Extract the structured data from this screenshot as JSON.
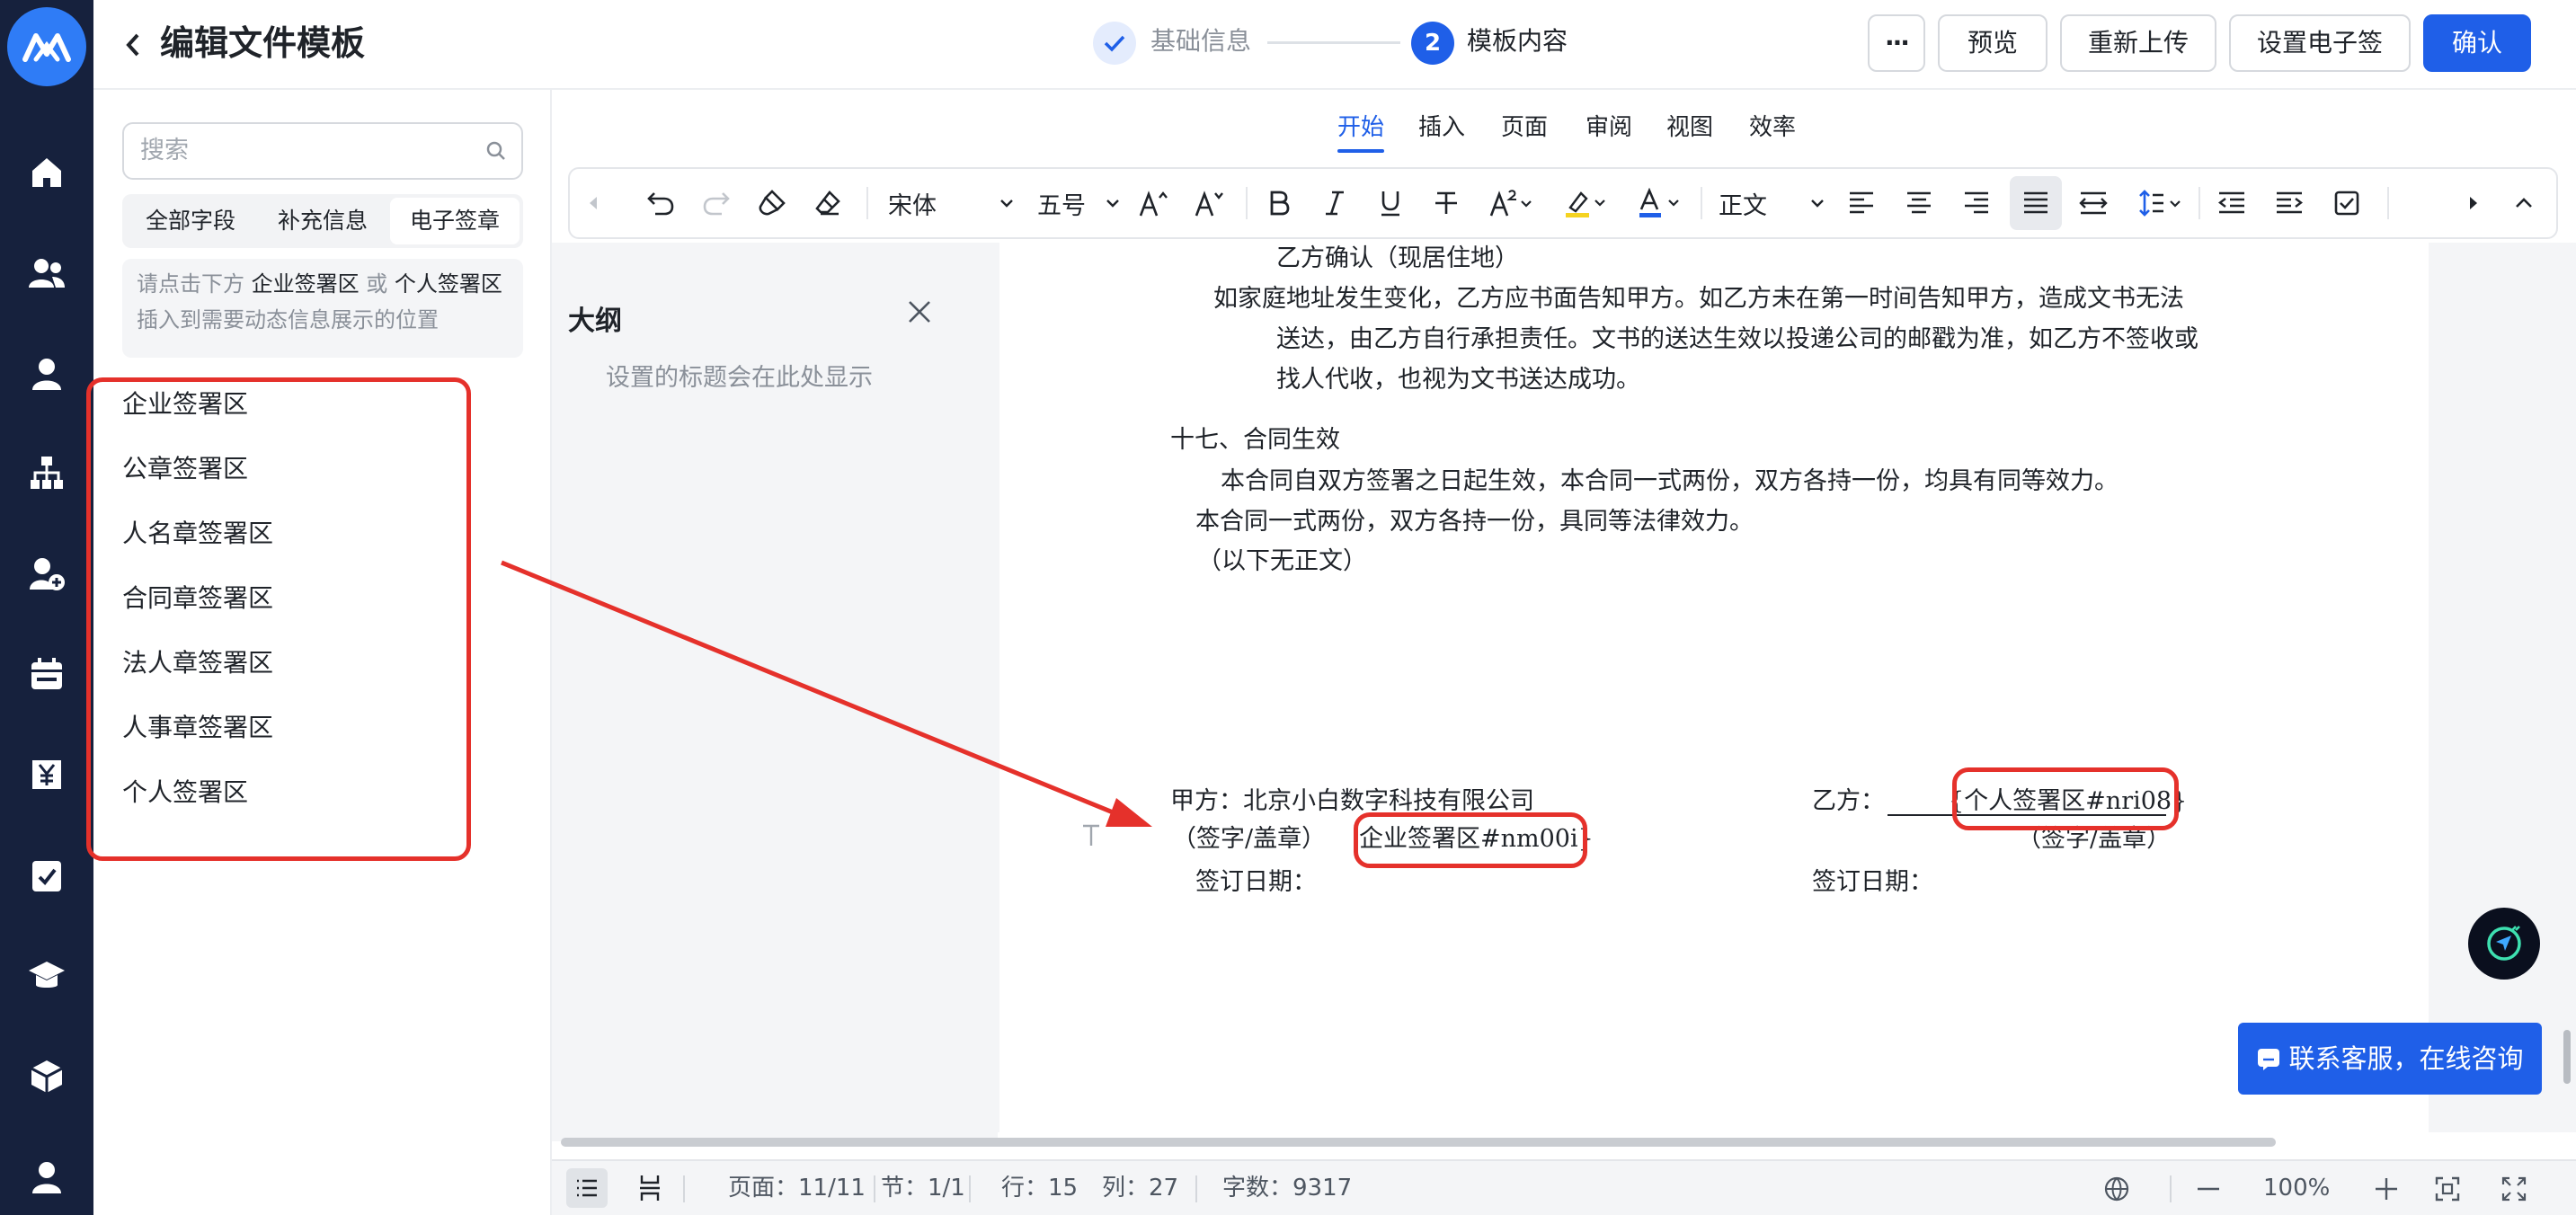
{
  "topbar": {
    "title": "编辑文件模板",
    "steps": [
      {
        "label": "基础信息",
        "state": "done"
      },
      {
        "label": "模板内容",
        "state": "current",
        "number": "2"
      }
    ],
    "more_label": "···",
    "preview_label": "预览",
    "reupload_label": "重新上传",
    "esign_label": "设置电子签",
    "confirm_label": "确认"
  },
  "nav": {
    "icons": [
      "home-icon",
      "team-icon",
      "user-icon",
      "org-chart-icon",
      "add-user-icon",
      "calendar-icon",
      "salary-icon",
      "approval-icon",
      "course-icon",
      "box-icon",
      "profile-icon"
    ]
  },
  "fields": {
    "search_placeholder": "搜索",
    "tabs": [
      "全部字段",
      "补充信息",
      "电子签章"
    ],
    "active_tab": 2,
    "hint": {
      "prefix": "请点击下方",
      "a": "企业签署区",
      "or": "或",
      "b": "个人签署区",
      "suffix": "插入到需要动态信息展示的位置"
    },
    "items": [
      "企业签署区",
      "公章签署区",
      "人名章签署区",
      "合同章签署区",
      "法人章签署区",
      "人事章签署区",
      "个人签署区"
    ]
  },
  "editor": {
    "menu_tabs": [
      "开始",
      "插入",
      "页面",
      "审阅",
      "视图",
      "效率"
    ],
    "active_menu": 0,
    "font": "宋体",
    "size": "五号",
    "style": "正文",
    "outline": {
      "title": "大纲",
      "hint": "设置的标题会在此处显示"
    },
    "doc": {
      "l1": "乙方确认（现居住地）",
      "l2": "如家庭地址发生变化，乙方应书面告知甲方。如乙方未在第一时间告知甲方，造成文书无法",
      "l3": "送达，由乙方自行承担责任。文书的送达生效以投递公司的邮戳为准，如乙方不签收或",
      "l4": "找人代收，也视为文书送达成功。",
      "l5": "十七、合同生效",
      "l6": "本合同自双方签署之日起生效，本合同一式两份，双方各持一份，均具有同等效力。",
      "l7": "本合同一式两份，双方各持一份，具同等法律效力。",
      "l8": "（以下无正文）",
      "party_a": "甲方：北京小白数字科技有限公司",
      "sign_a": "（签字/盖章）",
      "tag_a": "企业签署区#nm00i}",
      "date_a": "签订日期：",
      "party_b": "乙方：",
      "tag_b": "{个人签署区#nri08}",
      "sign_b": "（签字/盖章）",
      "date_b": "签订日期："
    }
  },
  "status": {
    "page": "页面：11/11",
    "section": "节：1/1",
    "row": "行：15",
    "col": "列：27",
    "words": "字数：9317",
    "zoom": "100%"
  },
  "support_label": "联系客服，在线咨询",
  "colors": {
    "accent": "#1f5fe8",
    "annotation": "#e5312b",
    "nav_bg": "#16213d"
  }
}
